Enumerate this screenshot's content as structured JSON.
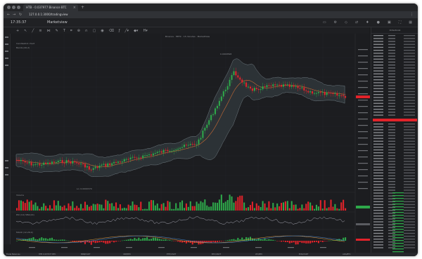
{
  "browser": {
    "tab_title": "HTB - 0.037977 Binance BTC",
    "tab_close": "×",
    "tab_add": "+",
    "url": "127.0.0.1:3000/tradingview",
    "nav_back": "←",
    "nav_forward": "→",
    "nav_reload": "↻",
    "menu": "⋮"
  },
  "app": {
    "clock": "17:35:37",
    "title": "Marketview",
    "top_icons": [
      "layout-icon",
      "settings-icon",
      "alert-icon",
      "compare-icon",
      "bell-icon",
      "user-icon",
      "camera-icon",
      "fullscreen-icon",
      "grid-icon"
    ]
  },
  "chart": {
    "pane_label": "Candlestick chart",
    "pane_sublabel": "Bands (20,2)",
    "symbol_line": "Binance · HBTC · 15 minutes · MarketView",
    "volume_label": "Volume",
    "rsi_label": "RSI (14) SMA(14)",
    "macd_label": "MACD (12,26,9)",
    "high_marker": "0.0000598",
    "low_marker": "Lo: 0.0000370"
  },
  "side_panel": {
    "title": "Orderbook"
  },
  "taskbar": {
    "items": [
      "Trade Balances",
      "HTB 0.037977 BTC",
      "BNB/USDT",
      "XRP/BTC",
      "ETH/USDT",
      "BTC/USDT",
      "LTC/BTC",
      "EOS/USDT",
      "ADA/BTC"
    ]
  },
  "colors": {
    "up": "#2ea84a",
    "down": "#e2232a",
    "band": "#6f7a80",
    "ma": "#c86a34",
    "background": "#1c1d20"
  }
}
